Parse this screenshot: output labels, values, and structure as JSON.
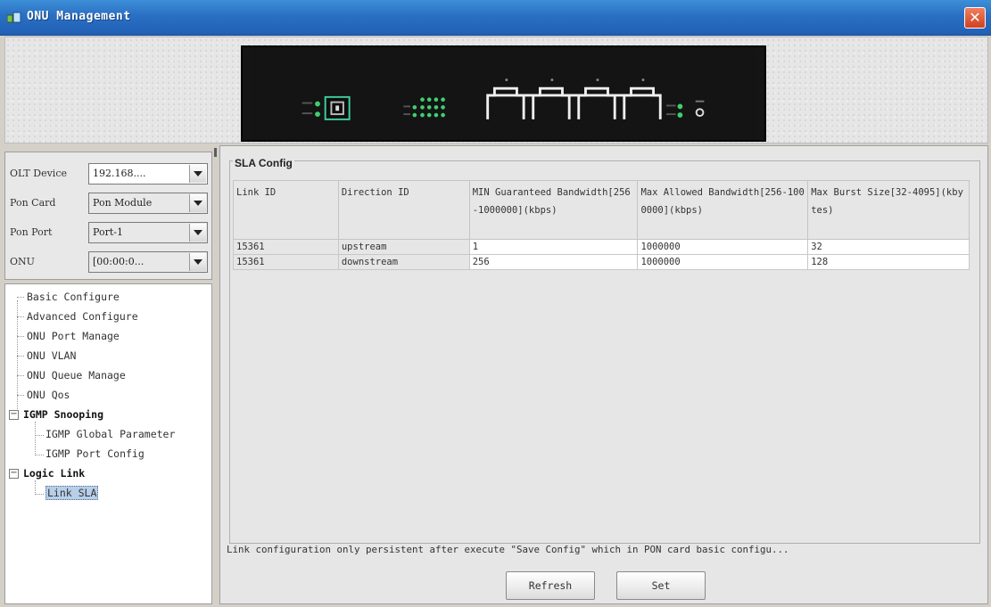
{
  "window": {
    "title": "ONU Management",
    "close_glyph": "✕"
  },
  "filters": [
    {
      "label": "OLT Device",
      "value": "192.168....",
      "editable": true
    },
    {
      "label": "Pon Card",
      "value": "Pon Module",
      "editable": false
    },
    {
      "label": "Pon Port",
      "value": "Port-1",
      "editable": false
    },
    {
      "label": "ONU",
      "value": "[00:00:0...",
      "editable": false
    }
  ],
  "tree": {
    "items": [
      {
        "label": "Basic Configure"
      },
      {
        "label": "Advanced Configure"
      },
      {
        "label": "ONU Port Manage"
      },
      {
        "label": "ONU VLAN"
      },
      {
        "label": "ONU Queue Manage"
      },
      {
        "label": "ONU Qos"
      },
      {
        "label": "IGMP Snooping",
        "expanded": true
      },
      {
        "label": "IGMP Global Parameter"
      },
      {
        "label": "IGMP Port Config"
      },
      {
        "label": "Logic Link",
        "expanded": true
      },
      {
        "label": "Link SLA",
        "selected": true
      }
    ]
  },
  "sla": {
    "group_title": "SLA Config",
    "columns": [
      "Link ID",
      "Direction ID",
      "MIN Guaranteed Bandwidth[256-1000000](kbps)",
      "Max Allowed Bandwidth[256-1000000](kbps)",
      "Max Burst Size[32-4095](kbytes)"
    ],
    "rows": [
      [
        "15361",
        "upstream",
        "1",
        "1000000",
        "32"
      ],
      [
        "15361",
        "downstream",
        "256",
        "1000000",
        "128"
      ]
    ]
  },
  "notice": "Link configuration only persistent after execute \"Save Config\" which in PON card basic configu...",
  "buttons": {
    "refresh": "Refresh",
    "set": "Set"
  },
  "icons": {
    "app": "network-device-icon",
    "close": "close-icon",
    "dropdown": "chevron-down-icon",
    "expander": "tree-collapse-icon"
  },
  "colors": {
    "titlebar": "#2a6fc3",
    "close": "#d04020",
    "selection": "#b8cfe9",
    "device_led": "#3fcf6f"
  }
}
